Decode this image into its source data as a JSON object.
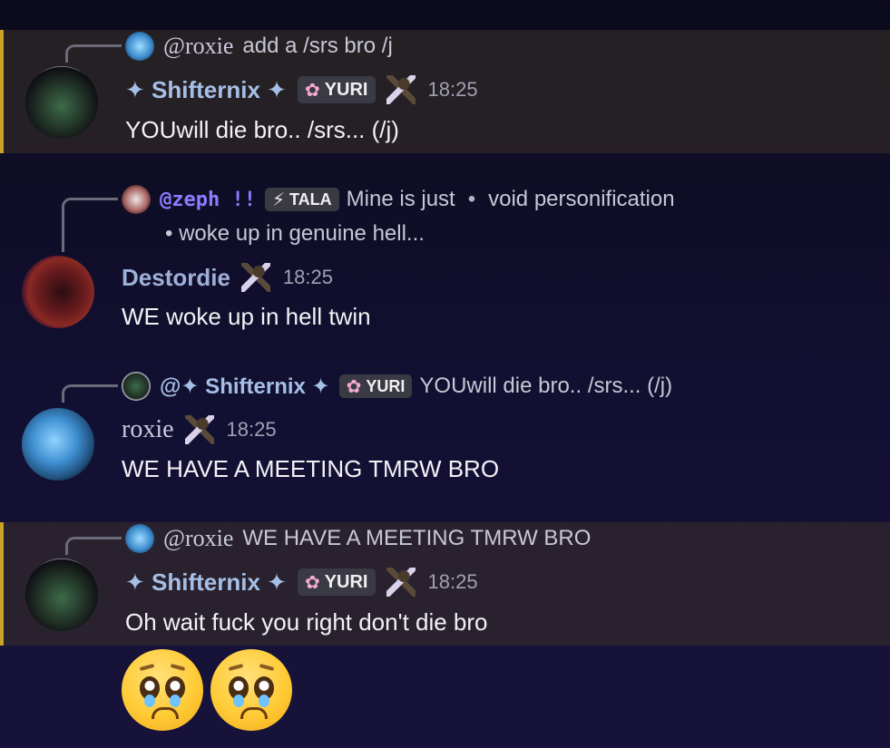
{
  "messages": [
    {
      "highlighted": true,
      "reply": {
        "handle": "@roxie",
        "text": "add a /srs bro /j"
      },
      "author": "✦ Shifternix ✦",
      "tag": "YURI",
      "time": "18:25",
      "body": "YOUwill die bro.. /srs... (/j)"
    },
    {
      "highlighted": false,
      "reply": {
        "handle": "@zeph !!",
        "tag": "TALA",
        "text": "Mine is just",
        "bullet_text": "void personification",
        "line2": "•  woke up in genuine hell..."
      },
      "author": "Destordie",
      "time": "18:25",
      "body": "WE woke up in hell twin"
    },
    {
      "highlighted": false,
      "reply": {
        "handle": "@✦ Shifternix ✦",
        "tag": "YURI",
        "text": "YOUwill die bro.. /srs... (/j)"
      },
      "author": "roxie",
      "time": "18:25",
      "body": "WE HAVE A MEETING TMRW BRO"
    },
    {
      "highlighted": true,
      "reply": {
        "handle": "@roxie",
        "text": "WE HAVE A MEETING TMRW BRO"
      },
      "author": "✦ Shifternix ✦",
      "tag": "YURI",
      "time": "18:25",
      "body": "Oh wait fuck you right don't die bro"
    }
  ],
  "reactions": [
    "pleading-face-emoji",
    "pleading-face-emoji"
  ],
  "colors": {
    "highlight_border": "#c9a227",
    "name_blue": "#a6bfe6",
    "zeph_purple": "#8c7cff",
    "background": "#121032"
  }
}
